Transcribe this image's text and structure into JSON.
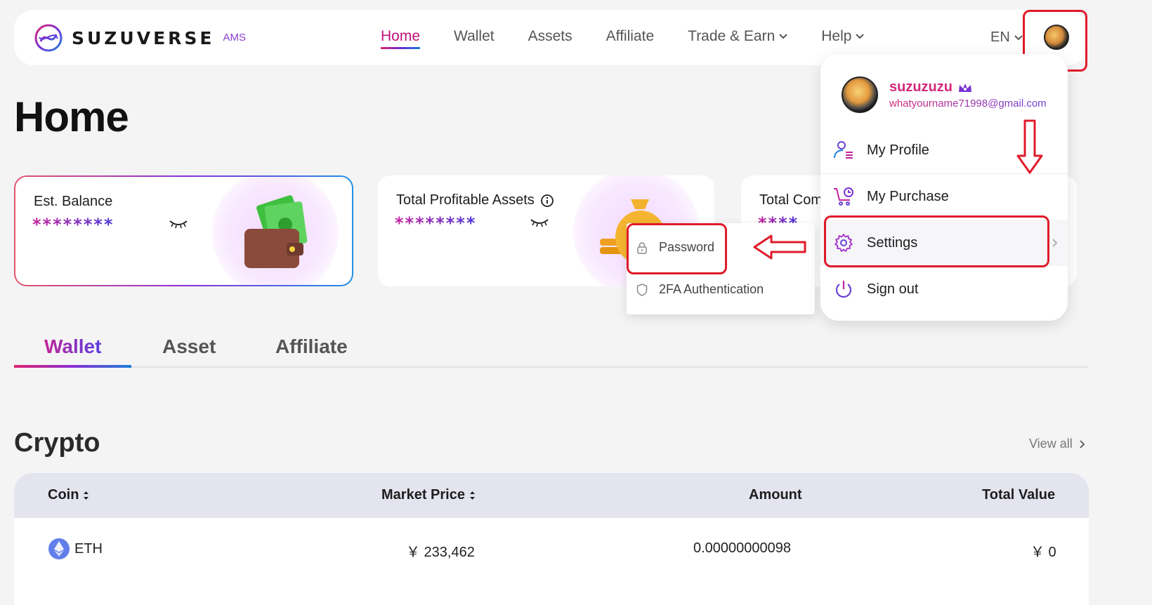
{
  "header": {
    "logo_text": "SUZUVERSE",
    "logo_suffix": "AMS",
    "nav": [
      {
        "label": "Home",
        "active": true
      },
      {
        "label": "Wallet"
      },
      {
        "label": "Assets"
      },
      {
        "label": "Affiliate"
      },
      {
        "label": "Trade & Earn",
        "dropdown": true
      },
      {
        "label": "Help",
        "dropdown": true
      }
    ],
    "language": "EN"
  },
  "page": {
    "title": "Home"
  },
  "cards": [
    {
      "label": "Est. Balance",
      "value": "********",
      "icon": "wallet-icon"
    },
    {
      "label": "Total Profitable Assets",
      "value": "********",
      "icon": "money-bag-icon"
    },
    {
      "label": "Total Com",
      "value": "****",
      "icon": ""
    }
  ],
  "tabs": [
    {
      "label": "Wallet",
      "active": true
    },
    {
      "label": "Asset"
    },
    {
      "label": "Affiliate"
    }
  ],
  "crypto": {
    "title": "Crypto",
    "view_all": "View all",
    "columns": [
      "Coin",
      "Market Price",
      "Amount",
      "Total Value"
    ],
    "rows": [
      {
        "coin": "ETH",
        "market_price": "￥ 233,462",
        "amount": "0.00000000098",
        "total_value": "￥ 0"
      }
    ]
  },
  "settings_submenu": {
    "items": [
      "Password",
      "2FA Authentication"
    ]
  },
  "user_menu": {
    "username": "suzuzuzu",
    "email": "whatyourname71998@gmail.com",
    "items": [
      "My Profile",
      "My Purchase",
      "Settings",
      "Sign out"
    ]
  },
  "colors": {
    "accent_pink": "#d5277a",
    "accent_purple": "#6a42d8",
    "annotation_red": "#e01b2a"
  }
}
